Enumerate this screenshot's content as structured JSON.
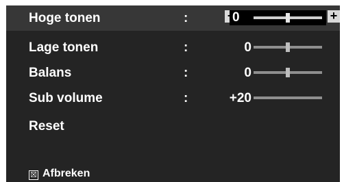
{
  "menu": {
    "items": [
      {
        "label": "Hoge tonen",
        "colon": ":",
        "value": "0",
        "level": 0.5,
        "selected": true
      },
      {
        "label": "Lage tonen",
        "colon": ":",
        "value": "0",
        "level": 0.5
      },
      {
        "label": "Balans",
        "colon": ":",
        "value": "0",
        "level": 0.5
      },
      {
        "label": "Sub volume",
        "colon": ":",
        "value": "+20"
      },
      {
        "label": "Reset"
      }
    ]
  },
  "stepper": {
    "minus": "−",
    "plus": "+"
  },
  "footer": {
    "close_icon": "☒",
    "label": "Afbreken"
  },
  "colors": {
    "panel_bg": "#242424",
    "selected_bg": "#373737",
    "text": "#ffffff"
  }
}
